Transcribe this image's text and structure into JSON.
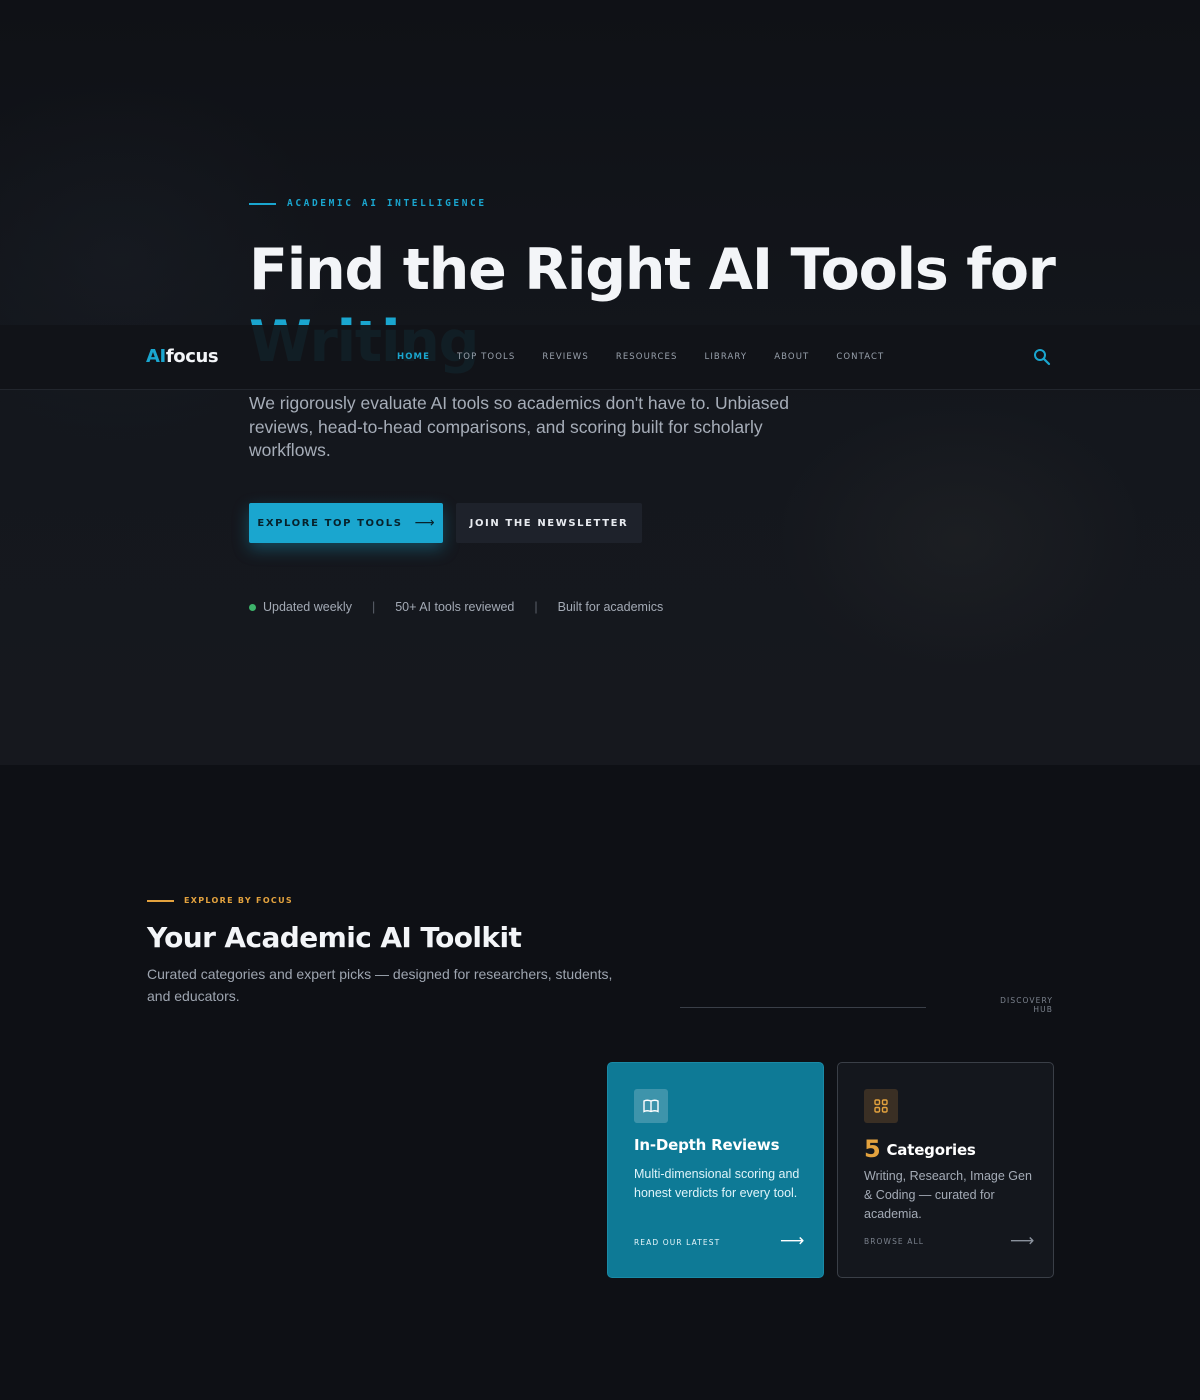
{
  "hero": {
    "eyebrow": "ACADEMIC AI INTELLIGENCE",
    "headline": "Find the Right AI Tools for",
    "headline_accent": "Writing",
    "lede": "We rigorously evaluate AI tools so academics don't have to. Unbiased reviews, head-to-head comparisons, and scoring built for scholarly workflows.",
    "primary_button": "EXPLORE TOP TOOLS",
    "secondary_button": "JOIN THE NEWSLETTER",
    "stats": [
      "Updated weekly",
      "50+ AI tools reviewed",
      "Built for academics"
    ],
    "separator": "|"
  },
  "nav": {
    "logo_ai": "AI",
    "logo_rest": "focus",
    "items": [
      "HOME",
      "TOP TOOLS",
      "REVIEWS",
      "RESOURCES",
      "LIBRARY",
      "ABOUT",
      "CONTACT"
    ],
    "active": "HOME",
    "search_icon": "search-icon"
  },
  "toolkit": {
    "kicker": "EXPLORE BY FOCUS",
    "title": "Your Academic AI Toolkit",
    "subtitle": "Curated categories and expert picks — designed for researchers, students, and educators.",
    "hub_label": "DISCOVERY HUB",
    "cards": [
      {
        "icon": "book-icon",
        "title": "In-Depth Reviews",
        "text": "Multi-dimensional scoring and honest verdicts for every tool.",
        "link": "READ OUR LATEST"
      },
      {
        "icon": "grid-icon",
        "number": "5",
        "title": "Categories",
        "text": "Writing, Research, Image Gen & Coding — curated for academia.",
        "link": "BROWSE ALL"
      }
    ]
  },
  "colors": {
    "accent": "#1aa6cf",
    "secondary_accent": "#e3a23e",
    "status_dot": "#3db36b",
    "background": "#0e1015"
  }
}
